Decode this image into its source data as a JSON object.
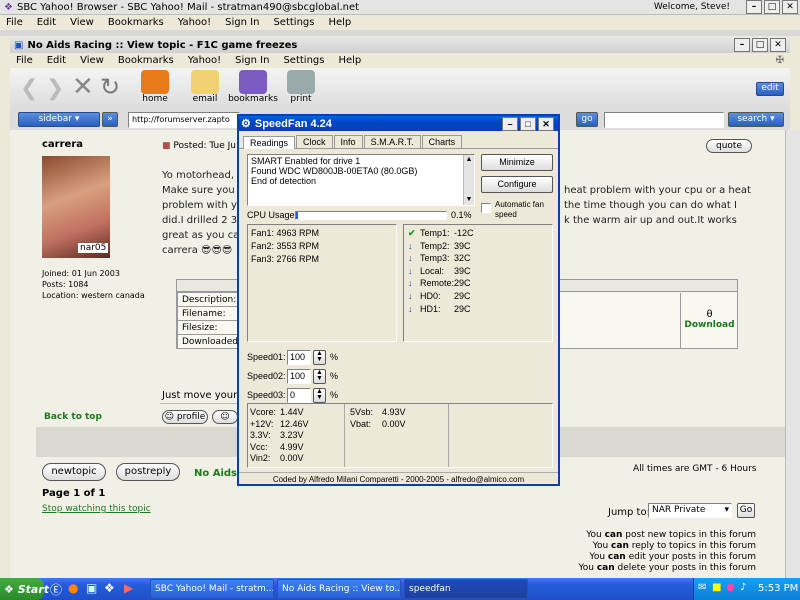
{
  "outer": {
    "title": "SBC Yahoo! Browser - SBC Yahoo! Mail - stratman490@sbcglobal.net",
    "welcome": "Welcome, Steve!",
    "menu": [
      "File",
      "Edit",
      "View",
      "Bookmarks",
      "Yahoo!",
      "Sign In",
      "Settings",
      "Help"
    ]
  },
  "inner": {
    "title": "No Aids Racing :: View topic - F1C game freezes",
    "menu": [
      "File",
      "Edit",
      "View",
      "Bookmarks",
      "Yahoo!",
      "Sign In",
      "Settings",
      "Help"
    ],
    "toolbar": {
      "home": "home",
      "email": "email",
      "bookmarks": "bookmarks",
      "print": "print",
      "edit": "edit"
    },
    "sidebar_label": "sidebar",
    "address": "http://forumserver.zapto",
    "go": "go",
    "search": "search"
  },
  "forum": {
    "author": "carrera",
    "avatar_caption": "nar05",
    "joined": "Joined: 01 Jun 2003",
    "posts": "Posts: 1084",
    "location": "Location: western canada",
    "posted": "Posted: Tue Ju",
    "quote": "quote",
    "body_lines": [
      "Yo motorhead,",
      "Make sure you",
      "problem with yo",
      "did.I drilled 2 3",
      "great as you ca",
      "carrera 😎😎😎"
    ],
    "body_right_lines": [
      "heat problem with your cpu or a heat",
      "the time though you can do what I",
      "k the warm air up and out.It works"
    ],
    "attach_labels": [
      "Description:",
      "Filename:",
      "Filesize:",
      "Downloaded"
    ],
    "download": "Download",
    "just_move": "Just move your",
    "back_to_top": "Back to top",
    "profile": "profile",
    "newtopic": "newtopic",
    "postreply": "postreply",
    "no_aids": "No Aids R",
    "times": "All times are GMT - 6 Hours",
    "page": "Page 1 of 1",
    "stop_watching": "Stop watching this topic",
    "jump_to": "Jump to:",
    "jump_value": "NAR Private",
    "jump_go": "Go",
    "perms": [
      {
        "a": "You ",
        "b": "can",
        "c": " post new topics in this forum"
      },
      {
        "a": "You ",
        "b": "can",
        "c": " reply to topics in this forum"
      },
      {
        "a": "You ",
        "b": "can",
        "c": " edit your posts in this forum"
      },
      {
        "a": "You ",
        "b": "can",
        "c": " delete your posts in this forum"
      }
    ]
  },
  "speedfan": {
    "title": "SpeedFan 4.24",
    "tabs": [
      "Readings",
      "Clock",
      "Info",
      "S.M.A.R.T.",
      "Charts"
    ],
    "log": [
      "SMART Enabled for drive 1",
      "Found WDC WD800JB-00ETA0 (80.0GB)",
      "End of detection"
    ],
    "minimize": "Minimize",
    "configure": "Configure",
    "auto_fan": "Automatic fan speed",
    "cpu_usage": "CPU Usage",
    "cpu_pct": "0.1%",
    "cpu_fraction": 0.001,
    "fans": [
      "Fan1: 4963 RPM",
      "Fan2: 3553 RPM",
      "Fan3: 2766 RPM"
    ],
    "temps": [
      {
        "label": "Temp1:",
        "value": "-12C",
        "icon": "check-icon"
      },
      {
        "label": "Temp2:",
        "value": "39C",
        "icon": "down-arrow-icon"
      },
      {
        "label": "Temp3:",
        "value": "32C",
        "icon": "down-arrow-icon"
      },
      {
        "label": "Local:",
        "value": "39C",
        "icon": "down-arrow-icon"
      },
      {
        "label": "Remote:",
        "value": "29C",
        "icon": "down-arrow-icon"
      },
      {
        "label": "HD0:",
        "value": "29C",
        "icon": "down-arrow-icon"
      },
      {
        "label": "HD1:",
        "value": "29C",
        "icon": "down-arrow-icon"
      }
    ],
    "speeds": [
      {
        "label": "Speed01:",
        "value": "100",
        "unit": "%"
      },
      {
        "label": "Speed02:",
        "value": "100",
        "unit": "%"
      },
      {
        "label": "Speed03:",
        "value": "0",
        "unit": "%"
      }
    ],
    "volts_left": [
      {
        "label": "Vcore:",
        "value": "1.44V"
      },
      {
        "label": "+12V:",
        "value": "12.46V"
      },
      {
        "label": "3.3V:",
        "value": "3.23V"
      },
      {
        "label": "Vcc:",
        "value": "4.99V"
      },
      {
        "label": "Vin2:",
        "value": "0.00V"
      }
    ],
    "volts_right": [
      {
        "label": "5Vsb:",
        "value": "4.93V"
      },
      {
        "label": "Vbat:",
        "value": "0.00V"
      }
    ],
    "footer": "Coded by Alfredo Milani Comparetti - 2000-2005 - alfredo@almico.com"
  },
  "taskbar": {
    "start": "Start",
    "tasks": [
      "SBC Yahoo! Mail - stratm...",
      "No Aids Racing :: View to...",
      "speedfan"
    ],
    "clock": "5:53 PM"
  }
}
